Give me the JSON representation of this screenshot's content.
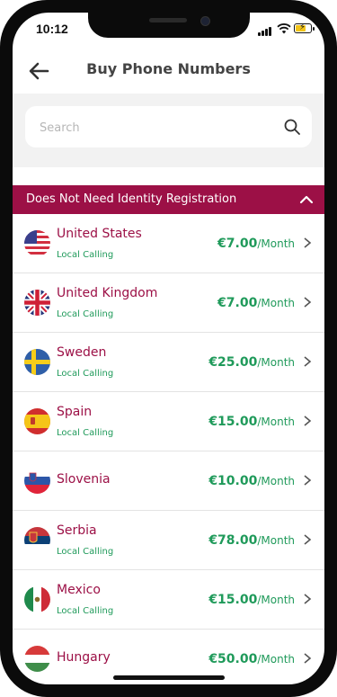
{
  "status_bar": {
    "time": "10:12"
  },
  "header": {
    "title": "Buy Phone Numbers"
  },
  "search": {
    "placeholder": "Search"
  },
  "section": {
    "label": "Does Not Need Identity Registration"
  },
  "countries": [
    {
      "name": "United States",
      "type": "Local Calling",
      "price": "€7.00",
      "period": "/Month",
      "flag": "us-flag-icon"
    },
    {
      "name": "United Kingdom",
      "type": "Local Calling",
      "price": "€7.00",
      "period": "/Month",
      "flag": "uk-flag-icon"
    },
    {
      "name": "Sweden",
      "type": "Local Calling",
      "price": "€25.00",
      "period": "/Month",
      "flag": "sweden-flag-icon"
    },
    {
      "name": "Spain",
      "type": "Local Calling",
      "price": "€15.00",
      "period": "/Month",
      "flag": "spain-flag-icon"
    },
    {
      "name": "Slovenia",
      "type": "",
      "price": "€10.00",
      "period": "/Month",
      "flag": "slovenia-flag-icon"
    },
    {
      "name": "Serbia",
      "type": "Local Calling",
      "price": "€78.00",
      "period": "/Month",
      "flag": "serbia-flag-icon"
    },
    {
      "name": "Mexico",
      "type": "Local Calling",
      "price": "€15.00",
      "period": "/Month",
      "flag": "mexico-flag-icon"
    },
    {
      "name": "Hungary",
      "type": "",
      "price": "€50.00",
      "period": "/Month",
      "flag": "hungary-flag-icon"
    }
  ],
  "colors": {
    "accent": "#9c1046",
    "price_green": "#1f9a5a",
    "header_text": "#444444"
  }
}
